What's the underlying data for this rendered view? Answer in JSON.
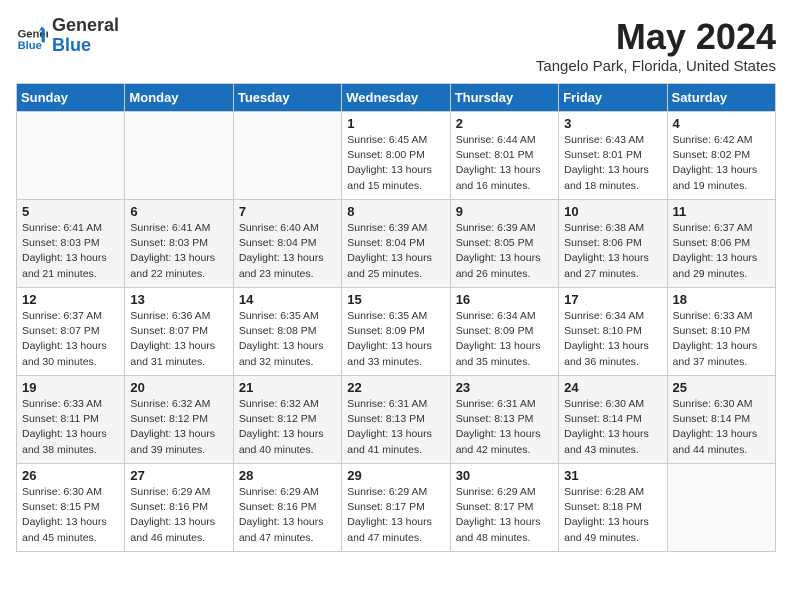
{
  "logo": {
    "general": "General",
    "blue": "Blue"
  },
  "title": "May 2024",
  "subtitle": "Tangelo Park, Florida, United States",
  "days_of_week": [
    "Sunday",
    "Monday",
    "Tuesday",
    "Wednesday",
    "Thursday",
    "Friday",
    "Saturday"
  ],
  "weeks": [
    [
      {
        "day": "",
        "content": ""
      },
      {
        "day": "",
        "content": ""
      },
      {
        "day": "",
        "content": ""
      },
      {
        "day": "1",
        "content": "Sunrise: 6:45 AM\nSunset: 8:00 PM\nDaylight: 13 hours\nand 15 minutes."
      },
      {
        "day": "2",
        "content": "Sunrise: 6:44 AM\nSunset: 8:01 PM\nDaylight: 13 hours\nand 16 minutes."
      },
      {
        "day": "3",
        "content": "Sunrise: 6:43 AM\nSunset: 8:01 PM\nDaylight: 13 hours\nand 18 minutes."
      },
      {
        "day": "4",
        "content": "Sunrise: 6:42 AM\nSunset: 8:02 PM\nDaylight: 13 hours\nand 19 minutes."
      }
    ],
    [
      {
        "day": "5",
        "content": "Sunrise: 6:41 AM\nSunset: 8:03 PM\nDaylight: 13 hours\nand 21 minutes."
      },
      {
        "day": "6",
        "content": "Sunrise: 6:41 AM\nSunset: 8:03 PM\nDaylight: 13 hours\nand 22 minutes."
      },
      {
        "day": "7",
        "content": "Sunrise: 6:40 AM\nSunset: 8:04 PM\nDaylight: 13 hours\nand 23 minutes."
      },
      {
        "day": "8",
        "content": "Sunrise: 6:39 AM\nSunset: 8:04 PM\nDaylight: 13 hours\nand 25 minutes."
      },
      {
        "day": "9",
        "content": "Sunrise: 6:39 AM\nSunset: 8:05 PM\nDaylight: 13 hours\nand 26 minutes."
      },
      {
        "day": "10",
        "content": "Sunrise: 6:38 AM\nSunset: 8:06 PM\nDaylight: 13 hours\nand 27 minutes."
      },
      {
        "day": "11",
        "content": "Sunrise: 6:37 AM\nSunset: 8:06 PM\nDaylight: 13 hours\nand 29 minutes."
      }
    ],
    [
      {
        "day": "12",
        "content": "Sunrise: 6:37 AM\nSunset: 8:07 PM\nDaylight: 13 hours\nand 30 minutes."
      },
      {
        "day": "13",
        "content": "Sunrise: 6:36 AM\nSunset: 8:07 PM\nDaylight: 13 hours\nand 31 minutes."
      },
      {
        "day": "14",
        "content": "Sunrise: 6:35 AM\nSunset: 8:08 PM\nDaylight: 13 hours\nand 32 minutes."
      },
      {
        "day": "15",
        "content": "Sunrise: 6:35 AM\nSunset: 8:09 PM\nDaylight: 13 hours\nand 33 minutes."
      },
      {
        "day": "16",
        "content": "Sunrise: 6:34 AM\nSunset: 8:09 PM\nDaylight: 13 hours\nand 35 minutes."
      },
      {
        "day": "17",
        "content": "Sunrise: 6:34 AM\nSunset: 8:10 PM\nDaylight: 13 hours\nand 36 minutes."
      },
      {
        "day": "18",
        "content": "Sunrise: 6:33 AM\nSunset: 8:10 PM\nDaylight: 13 hours\nand 37 minutes."
      }
    ],
    [
      {
        "day": "19",
        "content": "Sunrise: 6:33 AM\nSunset: 8:11 PM\nDaylight: 13 hours\nand 38 minutes."
      },
      {
        "day": "20",
        "content": "Sunrise: 6:32 AM\nSunset: 8:12 PM\nDaylight: 13 hours\nand 39 minutes."
      },
      {
        "day": "21",
        "content": "Sunrise: 6:32 AM\nSunset: 8:12 PM\nDaylight: 13 hours\nand 40 minutes."
      },
      {
        "day": "22",
        "content": "Sunrise: 6:31 AM\nSunset: 8:13 PM\nDaylight: 13 hours\nand 41 minutes."
      },
      {
        "day": "23",
        "content": "Sunrise: 6:31 AM\nSunset: 8:13 PM\nDaylight: 13 hours\nand 42 minutes."
      },
      {
        "day": "24",
        "content": "Sunrise: 6:30 AM\nSunset: 8:14 PM\nDaylight: 13 hours\nand 43 minutes."
      },
      {
        "day": "25",
        "content": "Sunrise: 6:30 AM\nSunset: 8:14 PM\nDaylight: 13 hours\nand 44 minutes."
      }
    ],
    [
      {
        "day": "26",
        "content": "Sunrise: 6:30 AM\nSunset: 8:15 PM\nDaylight: 13 hours\nand 45 minutes."
      },
      {
        "day": "27",
        "content": "Sunrise: 6:29 AM\nSunset: 8:16 PM\nDaylight: 13 hours\nand 46 minutes."
      },
      {
        "day": "28",
        "content": "Sunrise: 6:29 AM\nSunset: 8:16 PM\nDaylight: 13 hours\nand 47 minutes."
      },
      {
        "day": "29",
        "content": "Sunrise: 6:29 AM\nSunset: 8:17 PM\nDaylight: 13 hours\nand 47 minutes."
      },
      {
        "day": "30",
        "content": "Sunrise: 6:29 AM\nSunset: 8:17 PM\nDaylight: 13 hours\nand 48 minutes."
      },
      {
        "day": "31",
        "content": "Sunrise: 6:28 AM\nSunset: 8:18 PM\nDaylight: 13 hours\nand 49 minutes."
      },
      {
        "day": "",
        "content": ""
      }
    ]
  ]
}
